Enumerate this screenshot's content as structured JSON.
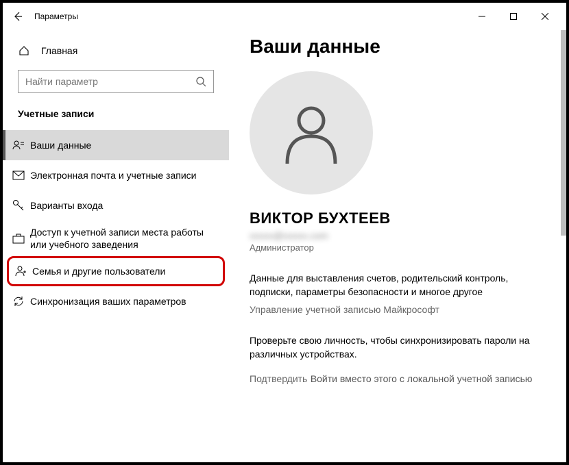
{
  "titlebar": {
    "title": "Параметры"
  },
  "sidebar": {
    "home": "Главная",
    "search_placeholder": "Найти параметр",
    "section": "Учетные записи",
    "items": [
      {
        "label": "Ваши данные"
      },
      {
        "label": "Электронная почта и учетные записи"
      },
      {
        "label": "Варианты входа"
      },
      {
        "label": "Доступ к учетной записи места работы или учебного заведения"
      },
      {
        "label": "Семья и другие пользователи"
      },
      {
        "label": "Синхронизация ваших параметров"
      }
    ]
  },
  "main": {
    "heading": "Ваши данные",
    "username": "ВИКТОР БУХТЕЕВ",
    "email_blurred": "xxxxx@xxxxx.com",
    "role": "Администратор",
    "billing_text": "Данные для выставления счетов, родительский контроль, подписки, параметры безопасности и многое другое",
    "manage_link": "Управление учетной записью Майкрософт",
    "verify_text": "Проверьте свою личность, чтобы синхронизировать пароли на различных устройствах.",
    "verify_link": "Подтвердить",
    "local_link": "Войти вместо этого с локальной учетной записью"
  }
}
